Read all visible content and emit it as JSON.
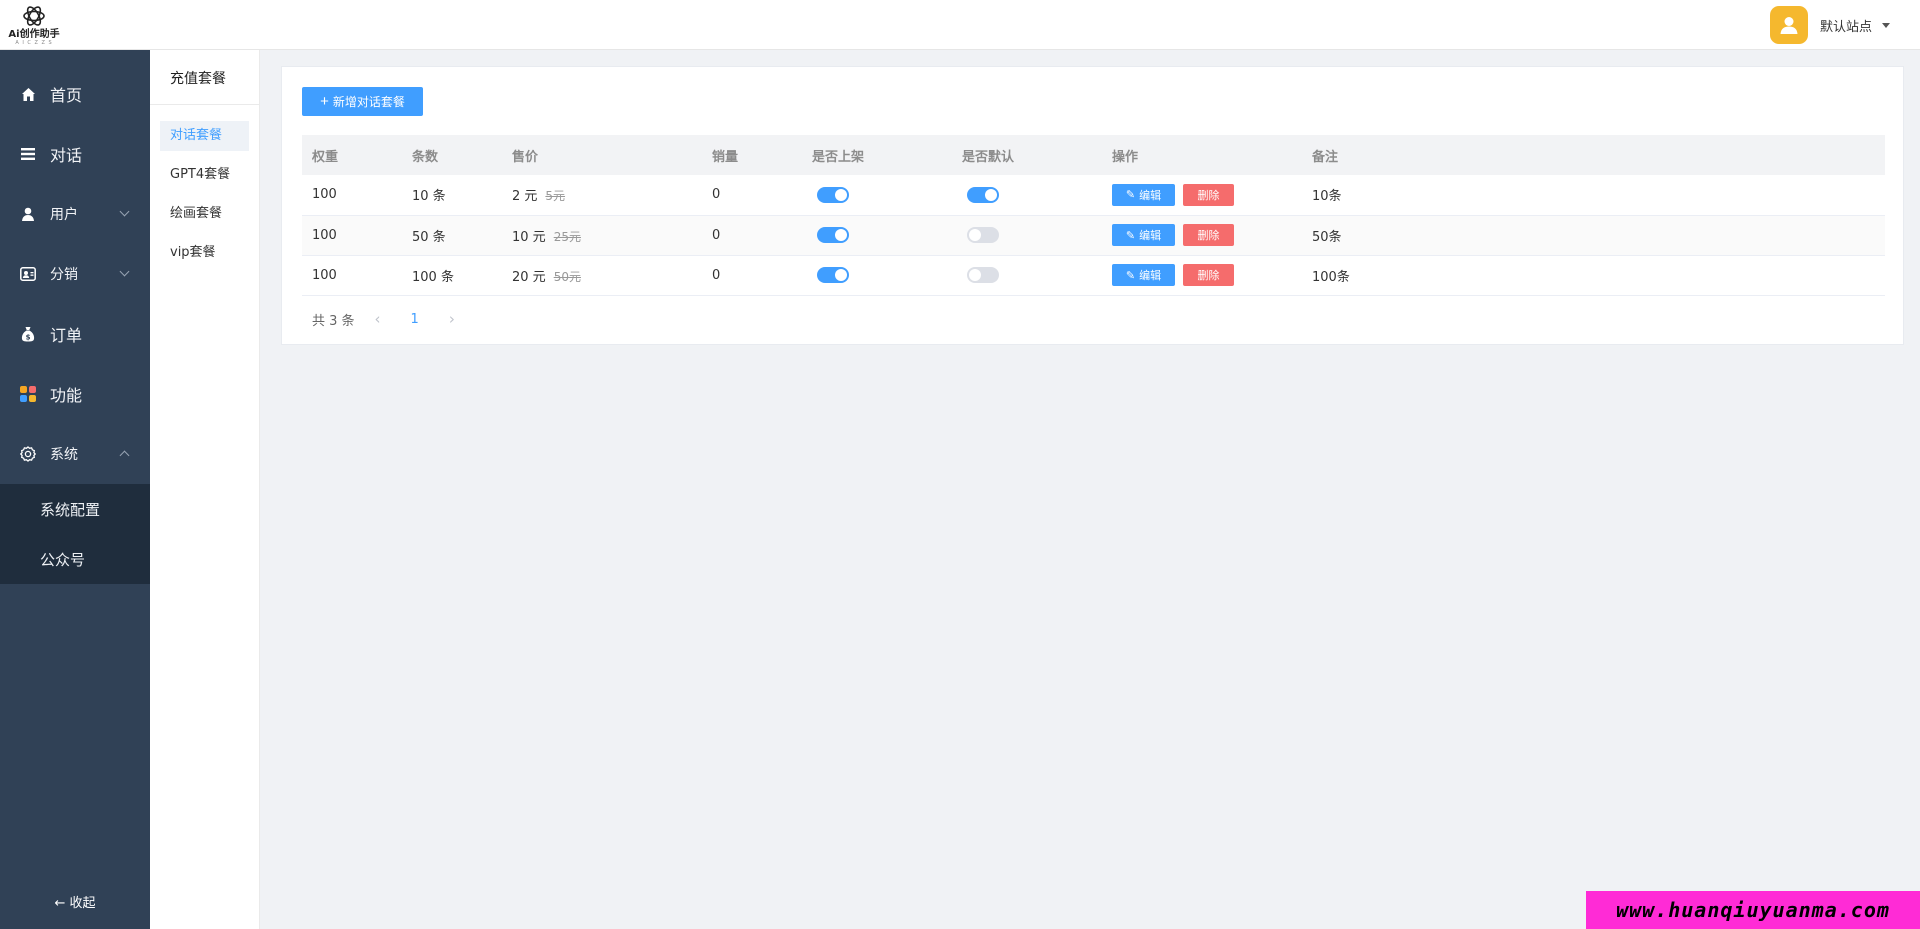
{
  "brand": {
    "name": "Ai创作助手",
    "sub": "A I C Z Z S"
  },
  "header": {
    "site_name": "默认站点"
  },
  "sidebar": {
    "items": [
      {
        "label": "首页",
        "icon": "home-icon"
      },
      {
        "label": "对话",
        "icon": "list-icon"
      },
      {
        "label": "用户",
        "icon": "user-icon"
      },
      {
        "label": "分销",
        "icon": "distribution-icon"
      },
      {
        "label": "订单",
        "icon": "money-bag-icon"
      },
      {
        "label": "功能",
        "icon": "apps-icon"
      },
      {
        "label": "系统",
        "icon": "gear-icon"
      }
    ],
    "system_sub": [
      "系统配置",
      "公众号"
    ],
    "collapse_label": "收起"
  },
  "subsidebar": {
    "title": "充值套餐",
    "items": [
      "对话套餐",
      "GPT4套餐",
      "绘画套餐",
      "vip套餐"
    ],
    "active": "对话套餐"
  },
  "toolbar": {
    "add_label": "新增对话套餐"
  },
  "table": {
    "columns": [
      "权重",
      "条数",
      "售价",
      "销量",
      "是否上架",
      "是否默认",
      "操作",
      "备注"
    ],
    "rows": [
      {
        "weight": "100",
        "count": "10 条",
        "price": "2 元",
        "orig_price": "5元",
        "sales": "0",
        "listed": true,
        "is_default": true,
        "note": "10条"
      },
      {
        "weight": "100",
        "count": "50 条",
        "price": "10 元",
        "orig_price": "25元",
        "sales": "0",
        "listed": true,
        "is_default": false,
        "note": "50条"
      },
      {
        "weight": "100",
        "count": "100 条",
        "price": "20 元",
        "orig_price": "50元",
        "sales": "0",
        "listed": true,
        "is_default": false,
        "note": "100条"
      }
    ],
    "edit_label": "编辑",
    "delete_label": "删除"
  },
  "pagination": {
    "total_text": "共 3 条",
    "current_page": "1"
  },
  "watermark": "www.huanqiuyuanma.com",
  "colors": {
    "sidebar_bg": "#304156",
    "submenu_bg": "#1f2d3d",
    "primary": "#409eff",
    "danger": "#f56c6c",
    "avatar": "#f5b82e",
    "watermark_bg": "#ff2bd6"
  }
}
